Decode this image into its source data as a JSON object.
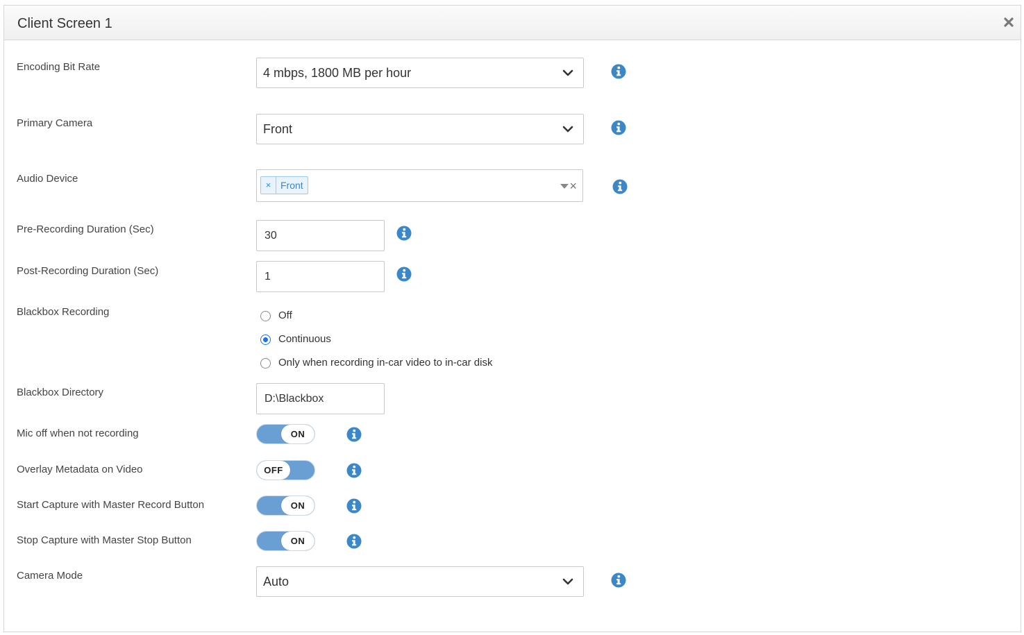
{
  "dialog": {
    "title": "Client Screen 1",
    "close_icon": "close-icon"
  },
  "colors": {
    "info_icon": "#3b87c8",
    "toggle_on": "#6a9fd3",
    "radio_selected": "#1a73e8",
    "tag_text": "#3b87c8"
  },
  "fields": {
    "encoding_bit_rate": {
      "label": "Encoding Bit Rate",
      "value": "4 mbps, 1800 MB per hour"
    },
    "primary_camera": {
      "label": "Primary Camera",
      "value": "Front"
    },
    "audio_device": {
      "label": "Audio Device",
      "tags": [
        "Front"
      ],
      "tag_remove": "×",
      "clear": "×"
    },
    "pre_recording": {
      "label": "Pre-Recording Duration (Sec)",
      "value": "30"
    },
    "post_recording": {
      "label": "Post-Recording Duration (Sec)",
      "value": "1"
    },
    "blackbox_recording": {
      "label": "Blackbox Recording",
      "options": [
        "Off",
        "Continuous",
        "Only when recording in-car video to in-car disk"
      ],
      "selected": "Continuous"
    },
    "blackbox_directory": {
      "label": "Blackbox Directory",
      "value": "D:\\Blackbox"
    },
    "mic_off": {
      "label": "Mic off when not recording",
      "state": "ON"
    },
    "overlay_metadata": {
      "label": "Overlay Metadata on Video",
      "state": "OFF"
    },
    "start_capture": {
      "label": "Start Capture with Master Record Button",
      "state": "ON"
    },
    "stop_capture": {
      "label": "Stop Capture with Master Stop Button",
      "state": "ON"
    },
    "camera_mode": {
      "label": "Camera Mode",
      "value": "Auto"
    }
  }
}
